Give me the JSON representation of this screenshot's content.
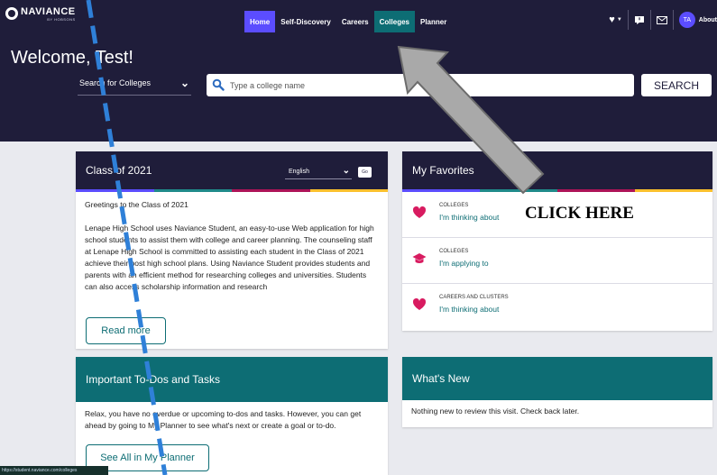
{
  "brand": {
    "name": "NAVIANCE",
    "sub": "BY HOBSONS"
  },
  "nav": [
    {
      "label": "Home",
      "active": true
    },
    {
      "label": "Self-Discovery"
    },
    {
      "label": "Careers"
    },
    {
      "label": "Colleges",
      "highlighted": true
    },
    {
      "label": "Planner"
    }
  ],
  "user": {
    "initials": "TA",
    "about": "About"
  },
  "welcome": "Welcome, Test!",
  "search": {
    "mode": "Search for Colleges",
    "placeholder": "Type a college name",
    "button": "SEARCH"
  },
  "class_card": {
    "title": "Class of 2021",
    "language": "English",
    "go": "Go",
    "greeting": "Greetings to the Class of 2021",
    "body": "Lenape High School uses Naviance Student, an easy-to-use Web application for high school students to assist them with college and career planning. The counseling staff at Lenape High School is committed to assisting each student in the Class of 2021 achieve their post high school plans. Using Naviance Student provides students and parents with an efficient method for researching colleges and universities. Students can also access scholarship information and research",
    "button": "Read more"
  },
  "favorites": {
    "title": "My Favorites",
    "items": [
      {
        "category": "COLLEGES",
        "link": "I'm thinking about",
        "icon": "heart-icon"
      },
      {
        "category": "COLLEGES",
        "link": "I'm applying to",
        "icon": "graduation-cap-icon"
      },
      {
        "category": "CAREERS AND CLUSTERS",
        "link": "I'm thinking about",
        "icon": "heart-icon"
      }
    ]
  },
  "todos": {
    "title": "Important To-Dos and Tasks",
    "text": "Relax, you have no overdue or upcoming to-dos and tasks. However, you can get ahead by going to My Planner to see what's next or create a goal or to-do.",
    "button": "See All in My Planner"
  },
  "whats_new": {
    "title": "What's New",
    "text": "Nothing new to review this visit. Check back later."
  },
  "status_url": "https://student.naviance.com/colleges",
  "annotation": "CLICK HERE",
  "colors": {
    "navy": "#1f1d3a",
    "teal": "#0d6d74",
    "home_active": "#5b4dff",
    "heart": "#d81b60",
    "stripe": [
      "#5b4dff",
      "#1f8a8a",
      "#ad1457",
      "#fbc02d"
    ]
  }
}
